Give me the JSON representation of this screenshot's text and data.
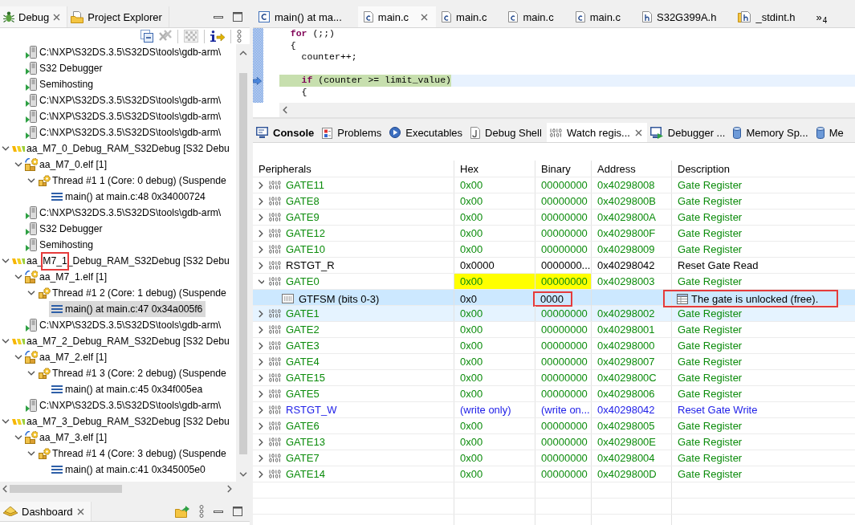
{
  "debug_view": {
    "tabs": [
      {
        "kind": "debug",
        "label": "Debug",
        "selected": true
      },
      {
        "kind": "project",
        "label": "Project Explorer",
        "selected": false
      }
    ],
    "toolbar": [
      {
        "buttons": [
          {
            "kind": "collapse",
            "disabled": false
          },
          {
            "kind": "remove",
            "disabled": true
          }
        ]
      },
      {
        "buttons": [
          {
            "kind": "filter",
            "disabled": true
          }
        ]
      },
      {
        "buttons": [
          {
            "kind": "step",
            "disabled": false
          }
        ]
      }
    ],
    "tree": [
      {
        "children": [
          {
            "kind": "process",
            "label": "C:\\NXP\\S32DS.3.5\\S32DS\\tools\\gdb-arm\\",
            "selected": false
          },
          {
            "kind": "process",
            "label": "S32 Debugger",
            "selected": false
          },
          {
            "kind": "process",
            "label": "Semihosting",
            "selected": false
          },
          {
            "kind": "process",
            "label": "C:\\NXP\\S32DS.3.5\\S32DS\\tools\\gdb-arm\\",
            "selected": false
          },
          {
            "kind": "process",
            "label": "C:\\NXP\\S32DS.3.5\\S32DS\\tools\\gdb-arm\\",
            "selected": false
          },
          {
            "kind": "process",
            "label": "C:\\NXP\\S32DS.3.5\\S32DS\\tools\\gdb-arm\\",
            "selected": false
          }
        ]
      },
      {
        "kind": "launch",
        "label": "aa_M7_0_Debug_RAM_S32Debug [S32 Debu",
        "selected": false,
        "expanded": true,
        "children": [
          {
            "kind": "target",
            "label": "aa_M7_0.elf [1]",
            "selected": false,
            "expanded": true,
            "children": [
              {
                "kind": "thread",
                "label": "Thread #1 1 (Core: 0 debug) (Suspende",
                "selected": false,
                "expanded": true,
                "children": [
                  {
                    "kind": "frame",
                    "label": "main() at main.c:48 0x34000724",
                    "selected": false
                  }
                ]
              }
            ]
          },
          {
            "kind": "process",
            "label": "C:\\NXP\\S32DS.3.5\\S32DS\\tools\\gdb-arm\\",
            "selected": false
          },
          {
            "kind": "process",
            "label": "S32 Debugger",
            "selected": false
          },
          {
            "kind": "process",
            "label": "Semihosting",
            "selected": false
          }
        ]
      },
      {
        "kind": "launch",
        "label_parts": [
          {
            "text": "aa_",
            "boxed": false
          },
          {
            "text": "M7_1",
            "boxed": true
          },
          {
            "text": "_Debug_RAM_S32Debug [S32 Debu",
            "boxed": false
          }
        ],
        "selected": false,
        "expanded": true,
        "children": [
          {
            "kind": "target",
            "label": "aa_M7_1.elf [1]",
            "selected": false,
            "expanded": true,
            "children": [
              {
                "kind": "thread",
                "label": "Thread #1 2 (Core: 1 debug) (Suspende",
                "selected": false,
                "expanded": true,
                "children": [
                  {
                    "kind": "frame",
                    "label": "main() at main.c:47 0x34a005f6",
                    "selected": true
                  }
                ]
              }
            ]
          },
          {
            "kind": "process",
            "label": "C:\\NXP\\S32DS.3.5\\S32DS\\tools\\gdb-arm\\",
            "selected": false
          }
        ]
      },
      {
        "kind": "launch",
        "label": "aa_M7_2_Debug_RAM_S32Debug [S32 Debu",
        "selected": false,
        "expanded": true,
        "children": [
          {
            "kind": "target",
            "label": "aa_M7_2.elf [1]",
            "selected": false,
            "expanded": true,
            "children": [
              {
                "kind": "thread",
                "label": "Thread #1 3 (Core: 2 debug) (Suspende",
                "selected": false,
                "expanded": true,
                "children": [
                  {
                    "kind": "frame",
                    "label": "main() at main.c:45 0x34f005ea",
                    "selected": false
                  }
                ]
              }
            ]
          },
          {
            "kind": "process",
            "label": "C:\\NXP\\S32DS.3.5\\S32DS\\tools\\gdb-arm\\",
            "selected": false
          }
        ]
      },
      {
        "kind": "launch",
        "label": "aa_M7_3_Debug_RAM_S32Debug [S32 Debu",
        "selected": false,
        "expanded": true,
        "children": [
          {
            "kind": "target",
            "label": "aa_M7_3.elf [1]",
            "selected": false,
            "expanded": true,
            "children": [
              {
                "kind": "thread",
                "label": "Thread #1 4 (Core: 3 debug) (Suspende",
                "selected": false,
                "expanded": true,
                "children": [
                  {
                    "kind": "frame",
                    "label": "main() at main.c:41 0x345005e0",
                    "selected": false
                  }
                ]
              }
            ]
          }
        ]
      }
    ]
  },
  "dashboard": {
    "tabs": [
      {
        "kind": "dashboard",
        "label": "Dashboard",
        "selected": true
      }
    ]
  },
  "editor": {
    "tabs": [
      {
        "kind": "c-source",
        "label": "main() at ma...",
        "selected": false
      },
      {
        "kind": "c",
        "label": "main.c",
        "selected": true
      },
      {
        "kind": "c",
        "label": "main.c",
        "selected": false
      },
      {
        "kind": "c",
        "label": "main.c",
        "selected": false
      },
      {
        "kind": "c",
        "label": "main.c",
        "selected": false
      },
      {
        "kind": "h",
        "label": "S32G399A.h",
        "selected": false
      },
      {
        "kind": "h-linked",
        "label": "_stdint.h",
        "selected": false
      }
    ],
    "overflow": {
      "symbol": "»",
      "count": "4"
    },
    "lines": [
      {
        "segments": [
          {
            "kind": "keyword",
            "text": "for"
          },
          {
            "kind": "plain",
            "text": " (;;)"
          }
        ],
        "current": false
      },
      {
        "segments": [
          {
            "kind": "plain",
            "text": "{"
          }
        ],
        "current": false,
        "children": [
          {
            "segments": [
              {
                "kind": "plain",
                "text": "counter++;"
              }
            ],
            "current": false
          },
          {
            "current": false
          },
          {
            "segments": [
              {
                "kind": "keyword",
                "text": "if"
              },
              {
                "kind": "plain",
                "text": " (counter >= limit_value)"
              }
            ],
            "current": true
          },
          {
            "segments": [
              {
                "kind": "plain",
                "text": "{"
              }
            ],
            "current": false
          }
        ]
      }
    ]
  },
  "watch_panel": {
    "tabs": [
      {
        "kind": "console",
        "label": "Console",
        "selected": false,
        "changed": true
      },
      {
        "kind": "problems",
        "label": "Problems",
        "selected": false,
        "changed": false
      },
      {
        "kind": "executables",
        "label": "Executables",
        "selected": false,
        "changed": false
      },
      {
        "kind": "shell",
        "label": "Debug Shell",
        "selected": false,
        "changed": false
      },
      {
        "kind": "registers",
        "label": "Watch regis...",
        "selected": true,
        "changed": false
      },
      {
        "kind": "debugger",
        "label": "Debugger ...",
        "selected": false,
        "changed": false
      },
      {
        "kind": "memory",
        "label": "Memory Sp...",
        "selected": false,
        "changed": false
      },
      {
        "kind": "memory",
        "label": "Me",
        "selected": false,
        "changed": false
      }
    ],
    "table": {
      "columns": [
        "Peripherals",
        "Hex",
        "Binary",
        "Address",
        "Description"
      ],
      "rows": [
        {
          "kind": "register",
          "name": "GATE11",
          "hex": "0x00",
          "binary": "00000000",
          "address": "0x40298008",
          "description": "Gate Register",
          "color": "#0c8c0c",
          "expanded": false,
          "changed": false,
          "selected": false,
          "hovered": false,
          "binary_boxed": false,
          "description_boxed": false
        },
        {
          "kind": "register",
          "name": "GATE8",
          "hex": "0x00",
          "binary": "00000000",
          "address": "0x4029800B",
          "description": "Gate Register",
          "color": "#0c8c0c",
          "expanded": false,
          "changed": false,
          "selected": false,
          "hovered": false,
          "binary_boxed": false,
          "description_boxed": false
        },
        {
          "kind": "register",
          "name": "GATE9",
          "hex": "0x00",
          "binary": "00000000",
          "address": "0x4029800A",
          "description": "Gate Register",
          "color": "#0c8c0c",
          "expanded": false,
          "changed": false,
          "selected": false,
          "hovered": false,
          "binary_boxed": false,
          "description_boxed": false
        },
        {
          "kind": "register",
          "name": "GATE12",
          "hex": "0x00",
          "binary": "00000000",
          "address": "0x4029800F",
          "description": "Gate Register",
          "color": "#0c8c0c",
          "expanded": false,
          "changed": false,
          "selected": false,
          "hovered": false,
          "binary_boxed": false,
          "description_boxed": false
        },
        {
          "kind": "register",
          "name": "GATE10",
          "hex": "0x00",
          "binary": "00000000",
          "address": "0x40298009",
          "description": "Gate Register",
          "color": "#0c8c0c",
          "expanded": false,
          "changed": false,
          "selected": false,
          "hovered": false,
          "binary_boxed": false,
          "description_boxed": false
        },
        {
          "kind": "register",
          "name": "RSTGT_R",
          "hex": "0x0000",
          "binary": "0000000...",
          "address": "0x40298042",
          "description": "Reset Gate Read",
          "color": "#000000",
          "expanded": false,
          "changed": false,
          "selected": false,
          "hovered": false,
          "binary_boxed": false,
          "description_boxed": false
        },
        {
          "kind": "register",
          "name": "GATE0",
          "hex": "0x00",
          "binary": "00000000",
          "address": "0x40298003",
          "description": "Gate Register",
          "color": "#0c8c0c",
          "expanded": true,
          "changed": true,
          "selected": false,
          "hovered": false,
          "binary_boxed": false,
          "description_boxed": false,
          "children": [
            {
              "kind": "field",
              "name": "GTFSM (bits 0-3)",
              "hex": "0x0",
              "binary": "0000",
              "description": "The gate is unlocked (free).",
              "color": "#000000",
              "changed": false,
              "selected": true,
              "hovered": false,
              "binary_boxed": true,
              "description_boxed": true
            }
          ]
        },
        {
          "kind": "register",
          "name": "GATE1",
          "hex": "0x00",
          "binary": "00000000",
          "address": "0x40298002",
          "description": "Gate Register",
          "color": "#0c8c0c",
          "expanded": false,
          "changed": false,
          "selected": false,
          "hovered": true,
          "binary_boxed": false,
          "description_boxed": false
        },
        {
          "kind": "register",
          "name": "GATE2",
          "hex": "0x00",
          "binary": "00000000",
          "address": "0x40298001",
          "description": "Gate Register",
          "color": "#0c8c0c",
          "expanded": false,
          "changed": false,
          "selected": false,
          "hovered": false,
          "binary_boxed": false,
          "description_boxed": false
        },
        {
          "kind": "register",
          "name": "GATE3",
          "hex": "0x00",
          "binary": "00000000",
          "address": "0x40298000",
          "description": "Gate Register",
          "color": "#0c8c0c",
          "expanded": false,
          "changed": false,
          "selected": false,
          "hovered": false,
          "binary_boxed": false,
          "description_boxed": false
        },
        {
          "kind": "register",
          "name": "GATE4",
          "hex": "0x00",
          "binary": "00000000",
          "address": "0x40298007",
          "description": "Gate Register",
          "color": "#0c8c0c",
          "expanded": false,
          "changed": false,
          "selected": false,
          "hovered": false,
          "binary_boxed": false,
          "description_boxed": false
        },
        {
          "kind": "register",
          "name": "GATE15",
          "hex": "0x00",
          "binary": "00000000",
          "address": "0x4029800C",
          "description": "Gate Register",
          "color": "#0c8c0c",
          "expanded": false,
          "changed": false,
          "selected": false,
          "hovered": false,
          "binary_boxed": false,
          "description_boxed": false
        },
        {
          "kind": "register",
          "name": "GATE5",
          "hex": "0x00",
          "binary": "00000000",
          "address": "0x40298006",
          "description": "Gate Register",
          "color": "#0c8c0c",
          "expanded": false,
          "changed": false,
          "selected": false,
          "hovered": false,
          "binary_boxed": false,
          "description_boxed": false
        },
        {
          "kind": "register",
          "name": "RSTGT_W",
          "hex": "(write only)",
          "binary": "(write on...",
          "address": "0x40298042",
          "description": "Reset Gate Write",
          "color": "#2121e8",
          "expanded": false,
          "changed": false,
          "selected": false,
          "hovered": false,
          "binary_boxed": false,
          "description_boxed": false
        },
        {
          "kind": "register",
          "name": "GATE6",
          "hex": "0x00",
          "binary": "00000000",
          "address": "0x40298005",
          "description": "Gate Register",
          "color": "#0c8c0c",
          "expanded": false,
          "changed": false,
          "selected": false,
          "hovered": false,
          "binary_boxed": false,
          "description_boxed": false
        },
        {
          "kind": "register",
          "name": "GATE13",
          "hex": "0x00",
          "binary": "00000000",
          "address": "0x4029800E",
          "description": "Gate Register",
          "color": "#0c8c0c",
          "expanded": false,
          "changed": false,
          "selected": false,
          "hovered": false,
          "binary_boxed": false,
          "description_boxed": false
        },
        {
          "kind": "register",
          "name": "GATE7",
          "hex": "0x00",
          "binary": "00000000",
          "address": "0x40298004",
          "description": "Gate Register",
          "color": "#0c8c0c",
          "expanded": false,
          "changed": false,
          "selected": false,
          "hovered": false,
          "binary_boxed": false,
          "description_boxed": false
        },
        {
          "kind": "register",
          "name": "GATE14",
          "hex": "0x00",
          "binary": "00000000",
          "address": "0x4029800D",
          "description": "Gate Register",
          "color": "#0c8c0c",
          "expanded": false,
          "changed": false,
          "selected": false,
          "hovered": false,
          "binary_boxed": false,
          "description_boxed": false
        }
      ]
    }
  }
}
